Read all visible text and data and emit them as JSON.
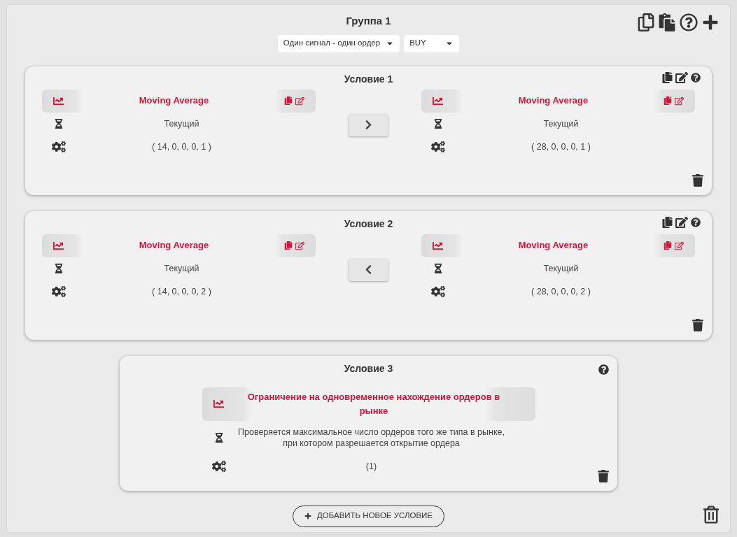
{
  "group": {
    "title": "Группа 1",
    "selects": [
      {
        "value": "Один сигнал - один ордер"
      },
      {
        "value": "BUY"
      }
    ]
  },
  "conditions": [
    {
      "kind": "compare",
      "title": "Условие 1",
      "operator": {
        "kind": "greater"
      },
      "operands": [
        {
          "name": "Moving Average",
          "period": "Текущий",
          "params": "( 14, 0, 0, 0, 1 )"
        },
        {
          "name": "Moving Average",
          "period": "Текущий",
          "params": "( 28, 0, 0, 0, 1 )"
        }
      ]
    },
    {
      "kind": "compare",
      "title": "Условие 2",
      "operator": {
        "kind": "less"
      },
      "operands": [
        {
          "name": "Moving Average",
          "period": "Текущий",
          "params": "( 14, 0, 0, 0, 2 )"
        },
        {
          "name": "Moving Average",
          "period": "Текущий",
          "params": "( 28, 0, 0, 0, 2 )"
        }
      ]
    },
    {
      "kind": "single",
      "title": "Условие 3",
      "operands": [
        {
          "name": "Ограничение на одновременное нахождение ордеров в рынке",
          "period": "Проверяется максимальное число ордеров того же типа в рынке, при котором разрешается открытие ордера",
          "params": "(1)"
        }
      ]
    }
  ],
  "add_button": "ДОБАВИТЬ НОВОЕ УСЛОВИЕ"
}
